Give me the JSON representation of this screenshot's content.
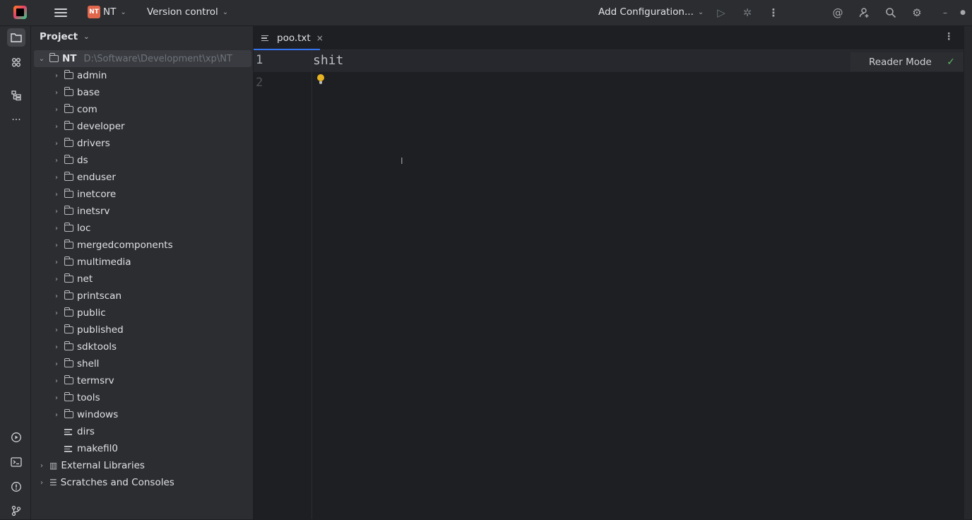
{
  "titlebar": {
    "project_badge": "NT",
    "project_name": "NT",
    "vcs_label": "Version control",
    "run_config_label": "Add Configuration...",
    "icons": [
      "app-logo",
      "hamburger-menu-icon",
      "run-icon",
      "debug-icon",
      "more-vert-icon",
      "ai-assistant-icon",
      "user-icon",
      "search-icon",
      "gear-icon",
      "minimize-icon"
    ]
  },
  "toolstrip": {
    "icons": [
      "folder-icon",
      "git-icon",
      "structure-icon",
      "more-icon",
      "run-icon",
      "terminal-icon",
      "problems-icon",
      "vcs-icon"
    ]
  },
  "project_panel": {
    "title": "Project",
    "root": {
      "name": "NT",
      "path": "D:\\Software\\Development\\xp\\NT"
    },
    "folders": [
      "admin",
      "base",
      "com",
      "developer",
      "drivers",
      "ds",
      "enduser",
      "inetcore",
      "inetsrv",
      "loc",
      "mergedcomponents",
      "multimedia",
      "net",
      "printscan",
      "public",
      "published",
      "sdktools",
      "shell",
      "termsrv",
      "tools",
      "windows"
    ],
    "files": [
      "dirs",
      "makefil0"
    ],
    "extra": [
      "External Libraries",
      "Scratches and Consoles"
    ]
  },
  "editor": {
    "tab_label": "poo.txt",
    "line_numbers": [
      "1",
      "2"
    ],
    "lines": [
      "shit",
      ""
    ],
    "reader_mode_label": "Reader Mode"
  },
  "colors": {
    "accent": "#3574f0",
    "background": "#1e1f22",
    "panel": "#2b2d30",
    "check": "#5fb865",
    "bulb": "#e6b422"
  }
}
